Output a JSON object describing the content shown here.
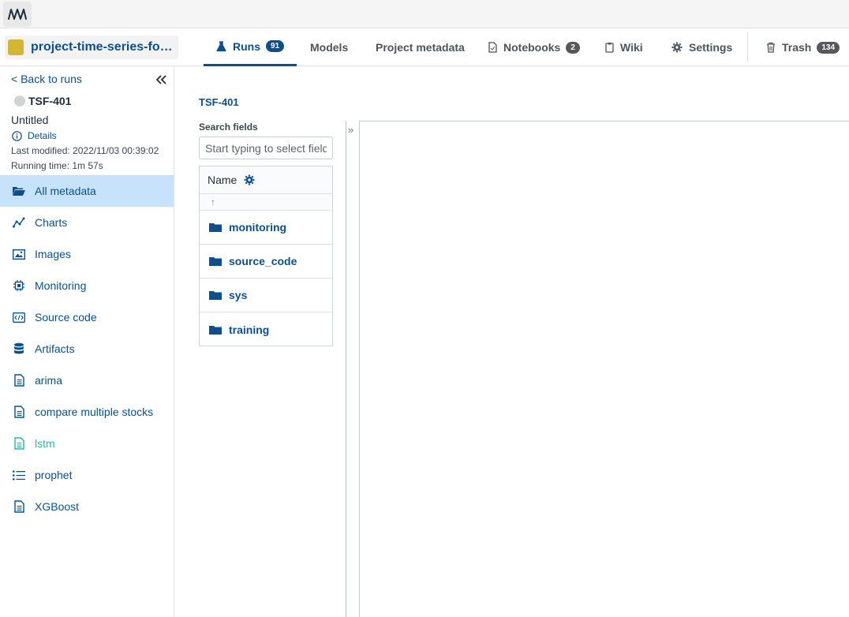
{
  "topbar": {
    "logo_icon": "neptune-wave-logo"
  },
  "project": {
    "name": "project-time-series-forecasting",
    "color": "#d4b634"
  },
  "tabs": [
    {
      "label": "Runs",
      "badge": "91",
      "icon": "flask-icon",
      "active": true
    },
    {
      "label": "Models",
      "icon": "",
      "active": false
    },
    {
      "label": "Project metadata",
      "icon": "",
      "active": false
    },
    {
      "label": "Notebooks",
      "badge": "2",
      "icon": "notebook-icon",
      "active": false
    },
    {
      "label": "Wiki",
      "icon": "clipboard-icon",
      "active": false
    },
    {
      "label": "Settings",
      "icon": "gear-icon",
      "active": false
    },
    {
      "label": "Trash",
      "badge": "134",
      "icon": "trash-icon",
      "active": false
    }
  ],
  "sidebar": {
    "back_label": "< Back to runs",
    "run_id": "TSF-401",
    "run_title": "Untitled",
    "details_label": "Details",
    "last_modified": "Last modified: 2022/11/03 00:39:02",
    "running_time": "Running time: 1m 57s",
    "items": [
      {
        "label": "All metadata",
        "icon": "folder-open-icon",
        "active": true
      },
      {
        "label": "Charts",
        "icon": "line-chart-icon"
      },
      {
        "label": "Images",
        "icon": "image-icon"
      },
      {
        "label": "Monitoring",
        "icon": "cpu-icon"
      },
      {
        "label": "Source code",
        "icon": "code-icon"
      },
      {
        "label": "Artifacts",
        "icon": "database-icon"
      },
      {
        "label": "arima",
        "icon": "document-icon"
      },
      {
        "label": "compare multiple stocks",
        "icon": "document-icon"
      },
      {
        "label": "lstm",
        "icon": "document-icon"
      },
      {
        "label": "prophet",
        "icon": "list-icon"
      },
      {
        "label": "XGBoost",
        "icon": "document-icon"
      }
    ]
  },
  "main": {
    "breadcrumb": "TSF-401",
    "search_label": "Search fields",
    "search_placeholder": "Start typing to select fields...",
    "tree_header": "Name",
    "tree_up": "↑",
    "folders": [
      "monitoring",
      "source_code",
      "sys",
      "training"
    ],
    "expand_label": "»"
  },
  "colors": {
    "accent": "#0d4f8b",
    "active_nav_bg": "#c6e3fb",
    "lstm_teal": "#2bb5a5"
  }
}
